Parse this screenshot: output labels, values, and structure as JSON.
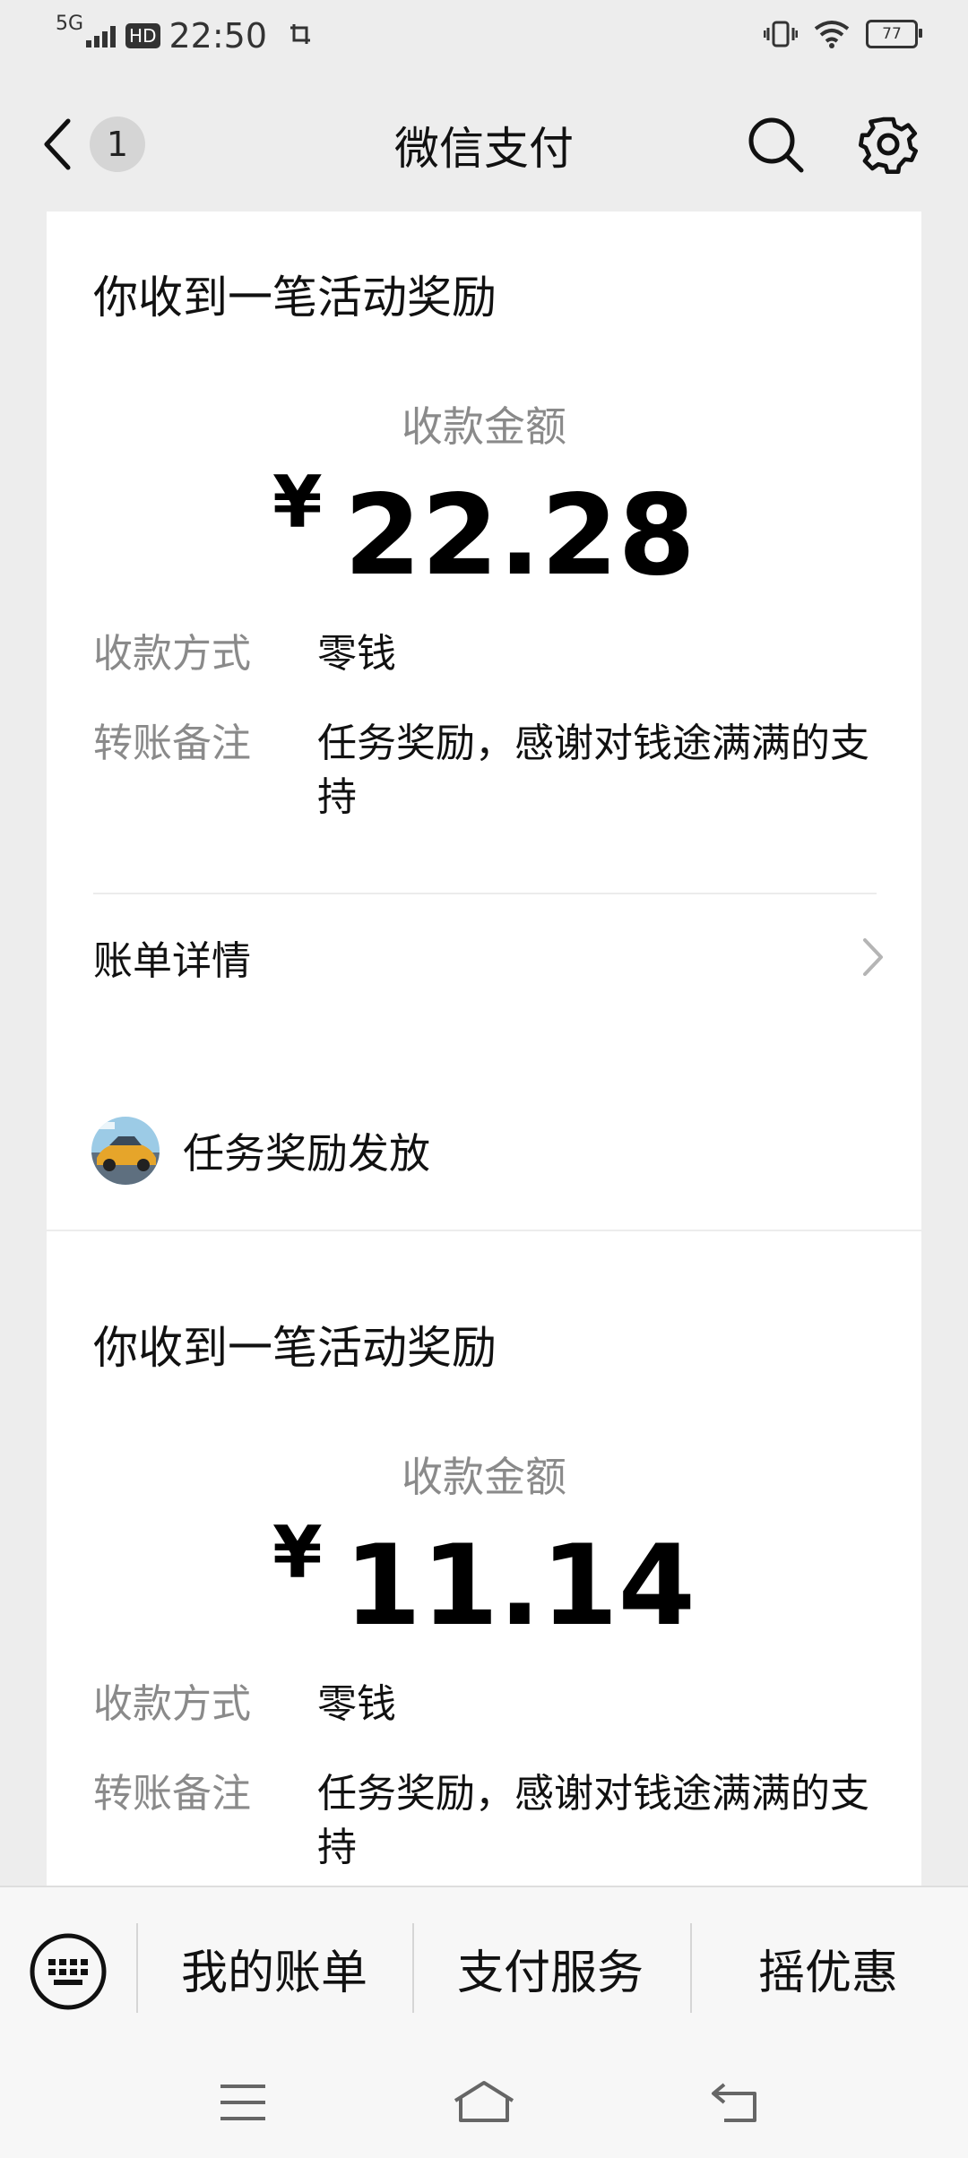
{
  "status_bar": {
    "network": "5G",
    "hd": "HD",
    "time": "22:50",
    "battery": "77"
  },
  "nav": {
    "unread_count": "1",
    "title": "微信支付"
  },
  "messages": [
    {
      "title": "你收到一笔活动奖励",
      "amount_label": "收款金额",
      "currency": "¥",
      "amount": "22.28",
      "rows": [
        {
          "key": "收款方式",
          "value": "零钱"
        },
        {
          "key": "转账备注",
          "value": "任务奖励，感谢对钱途满满的支持"
        }
      ],
      "detail_label": "账单详情"
    },
    {
      "sender": "任务奖励发放",
      "title": "你收到一笔活动奖励",
      "amount_label": "收款金额",
      "currency": "¥",
      "amount": "11.14",
      "rows": [
        {
          "key": "收款方式",
          "value": "零钱"
        },
        {
          "key": "转账备注",
          "value": "任务奖励，感谢对钱途满满的支持"
        }
      ]
    }
  ],
  "bottom_menu": {
    "items": [
      "我的账单",
      "支付服务",
      "摇优惠"
    ]
  },
  "colors": {
    "background": "#ededed",
    "card": "#ffffff",
    "muted_text": "#8a8a8a"
  }
}
